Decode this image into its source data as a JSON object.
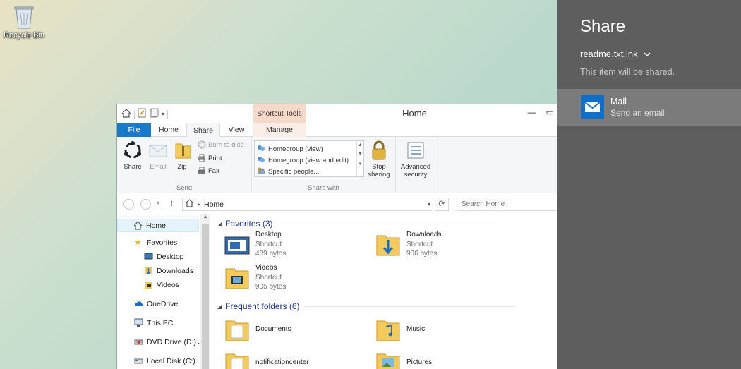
{
  "desktop": {
    "recycle_bin_label": "Recycle Bin"
  },
  "window": {
    "title": "Home",
    "contextual_tab_group": "Shortcut Tools",
    "tabs": [
      "File",
      "Home",
      "Share",
      "View",
      "Manage"
    ],
    "active_tab": "Share",
    "ribbon": {
      "send_group": {
        "label": "Send",
        "share": "Share",
        "email": "Email",
        "zip": "Zip",
        "burn": "Burn to disc",
        "print": "Print",
        "fax": "Fax"
      },
      "share_with_group": {
        "label": "Share with",
        "items": [
          "Homegroup (view)",
          "Homegroup (view and edit)",
          "Specific people..."
        ],
        "stop_sharing_line1": "Stop",
        "stop_sharing_line2": "sharing"
      },
      "advanced_security_line1": "Advanced",
      "advanced_security_line2": "security"
    },
    "address": {
      "path": "Home"
    },
    "search": {
      "placeholder": "Search Home"
    },
    "nav": {
      "home": "Home",
      "favorites": "Favorites",
      "desktop": "Desktop",
      "downloads": "Downloads",
      "videos": "Videos",
      "onedrive": "OneDrive",
      "this_pc": "This PC",
      "dvd": "DVD Drive (D:) JM",
      "local_disk": "Local Disk (C:)"
    },
    "content": {
      "favorites_header": "Favorites (3)",
      "favorites": [
        {
          "name": "Desktop",
          "type": "Shortcut",
          "size": "489 bytes"
        },
        {
          "name": "Downloads",
          "type": "Shortcut",
          "size": "906 bytes"
        },
        {
          "name": "Videos",
          "type": "Shortcut",
          "size": "905 bytes"
        }
      ],
      "frequent_header": "Frequent folders (6)",
      "frequent": [
        "Documents",
        "Music",
        "notificationcenter",
        "Pictures"
      ]
    }
  },
  "share_charm": {
    "title": "Share",
    "item_name": "readme.txt.lnk",
    "note": "This item will be shared.",
    "app_name": "Mail",
    "app_desc": "Send an email"
  },
  "colors": {
    "file_tab": "#1979ca",
    "charm_bg": "#5e5e5e",
    "charm_selected": "#7b7b7b",
    "mail_tile": "#0f6fc6",
    "section_header": "#1e3287"
  }
}
